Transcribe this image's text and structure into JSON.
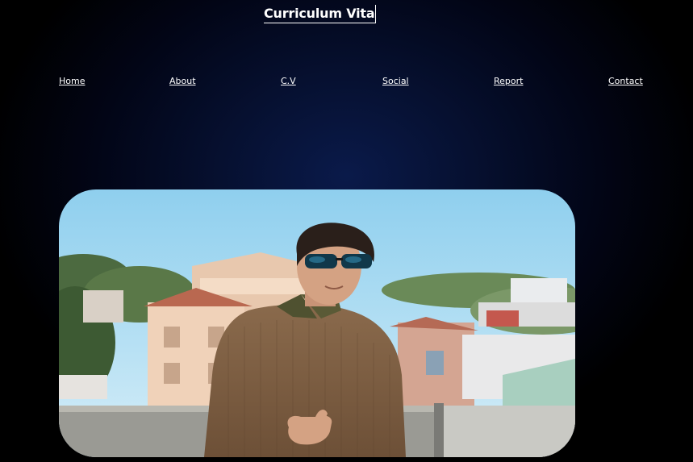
{
  "header": {
    "title": "Curriculum Vitae"
  },
  "nav": {
    "items": [
      {
        "label": "Home"
      },
      {
        "label": "About"
      },
      {
        "label": "C.V"
      },
      {
        "label": "Social"
      },
      {
        "label": "Report"
      },
      {
        "label": "Contact"
      }
    ]
  },
  "colors": {
    "background": "#000000",
    "glow": "#0a1a4a",
    "text": "#ffffff"
  }
}
